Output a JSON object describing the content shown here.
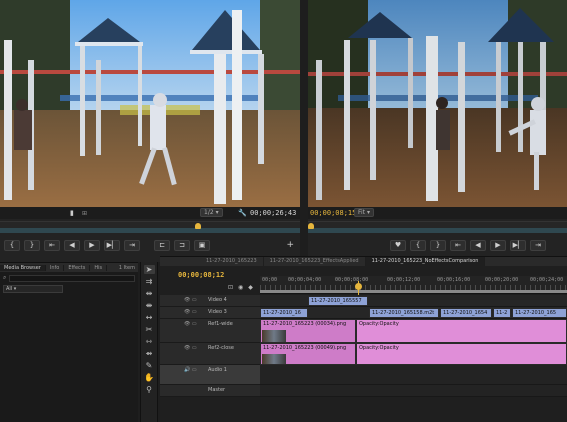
{
  "source_monitor": {
    "timecode": "00;00;26;43",
    "zoom": "1/2"
  },
  "program_monitor": {
    "timecode": "00;00;08;15",
    "zoom": "Fit"
  },
  "project_panel": {
    "tabs": [
      "Media Browser",
      "Info",
      "Effects",
      "His"
    ],
    "item_count": "1 Item",
    "filter_value": "All"
  },
  "timeline": {
    "tabs": [
      "11-27-2010_165223",
      "11-27-2010_165223_EffectsApplied",
      "11-27-2010_165223_NoEffectsComparison"
    ],
    "active_tab_index": 2,
    "timecode": "00;00;08;12",
    "ruler_labels": [
      "00;00",
      "00;00;04;00",
      "00;00;08;00",
      "00;00;12;00",
      "00;00;16;00",
      "00;00;20;00",
      "00;00;24;00"
    ],
    "tracks": [
      {
        "name": "Video 4"
      },
      {
        "name": "Video 3"
      },
      {
        "name": "Ref1-wide"
      },
      {
        "name": "Ref2-close"
      },
      {
        "name": "Audio 1"
      },
      {
        "name": "Master"
      }
    ],
    "clips": {
      "v4_a": "11-27-2010_165557",
      "v3_a": "11-27-2010_16",
      "v3_b": "11-27-2010_165158.m2t",
      "v3_c": "11-27-2010_1654",
      "v3_d": "11-2",
      "v3_e": "11-27-2010_165",
      "ref1_a": "11-27-2010_165223 (00034).png",
      "ref1_b": "Opacity:Opacity",
      "ref2_a": "11-27-2010_165223 (00049).png",
      "ref2_b": "Opacity:Opacity"
    }
  }
}
